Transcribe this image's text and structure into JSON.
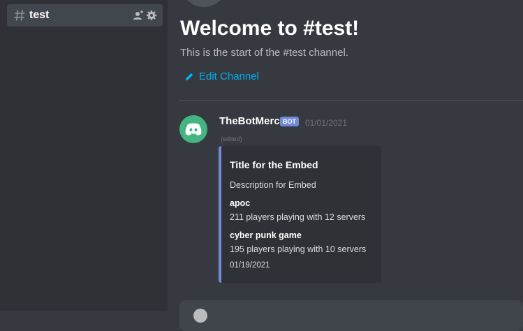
{
  "sidebar": {
    "channel": {
      "name": "test",
      "icon": "hash-icon",
      "actions": [
        "add-member-icon",
        "gear-icon"
      ]
    }
  },
  "welcome": {
    "title": "Welcome to #test!",
    "subtitle": "This is the start of the #test channel.",
    "edit_label": "Edit Channel"
  },
  "message": {
    "author": "TheBotMerc",
    "badge": "BOT",
    "timestamp": "01/01/2021",
    "edited": "(edited)",
    "embed": {
      "title": "Title for the Embed",
      "description": "Description for Embed",
      "fields": [
        {
          "name": "apoc",
          "value": "211 players playing with 12 servers"
        },
        {
          "name": "cyber punk game",
          "value": "195 players playing with 10 servers"
        }
      ],
      "footer": "01/19/2021",
      "accent_color": "#7289da"
    }
  },
  "colors": {
    "background": "#36393f",
    "sidebar": "#2f3136",
    "link": "#00aff4",
    "avatar": "#43b581"
  }
}
